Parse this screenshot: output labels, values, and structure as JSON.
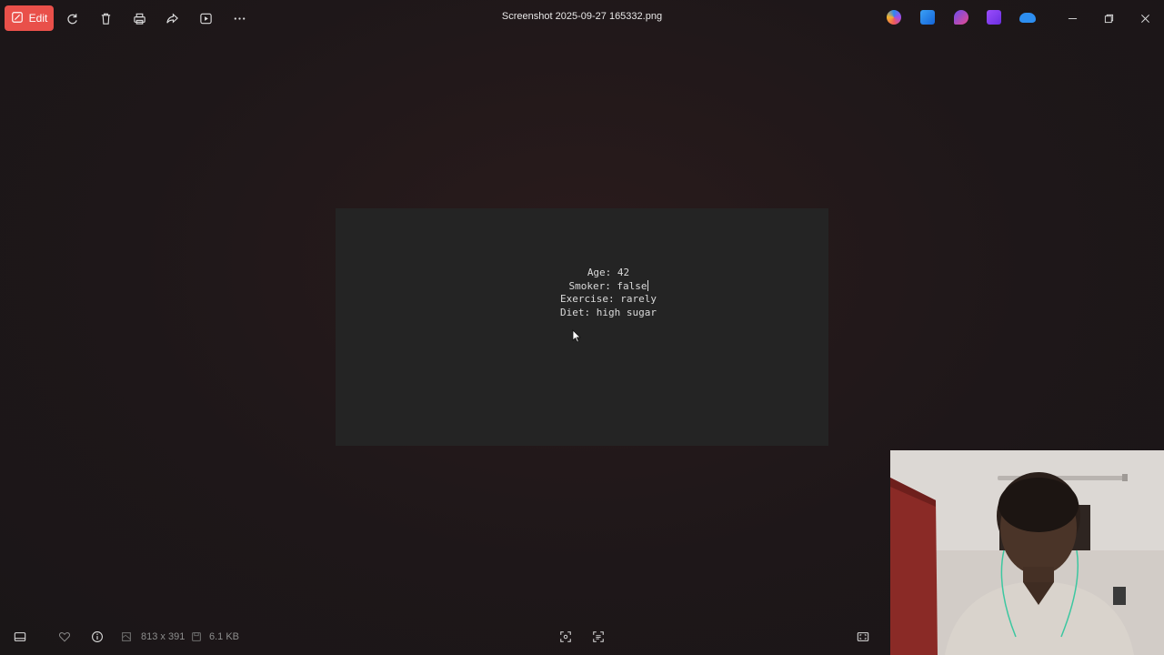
{
  "toolbar": {
    "edit_label": "Edit",
    "icons": [
      "edit-icon",
      "rotate-icon",
      "delete-icon",
      "print-icon",
      "share-icon",
      "slideshow-icon",
      "more-icon"
    ]
  },
  "window": {
    "title": "Screenshot 2025-09-27 165332.png"
  },
  "taskbar_apps": [
    "copilot-icon",
    "designer-icon",
    "clipchamp-icon",
    "video-editor-icon",
    "onedrive-icon"
  ],
  "image_content": {
    "lines": [
      "Age: 42",
      "Smoker: false",
      "Exercise: rarely",
      "Diet: high sugar"
    ]
  },
  "statusbar": {
    "dimensions": "813 x 391",
    "file_size": "6.1 KB"
  },
  "colors": {
    "accent": "#e9504a",
    "background": "#1d1718",
    "image_bg": "#242424"
  }
}
